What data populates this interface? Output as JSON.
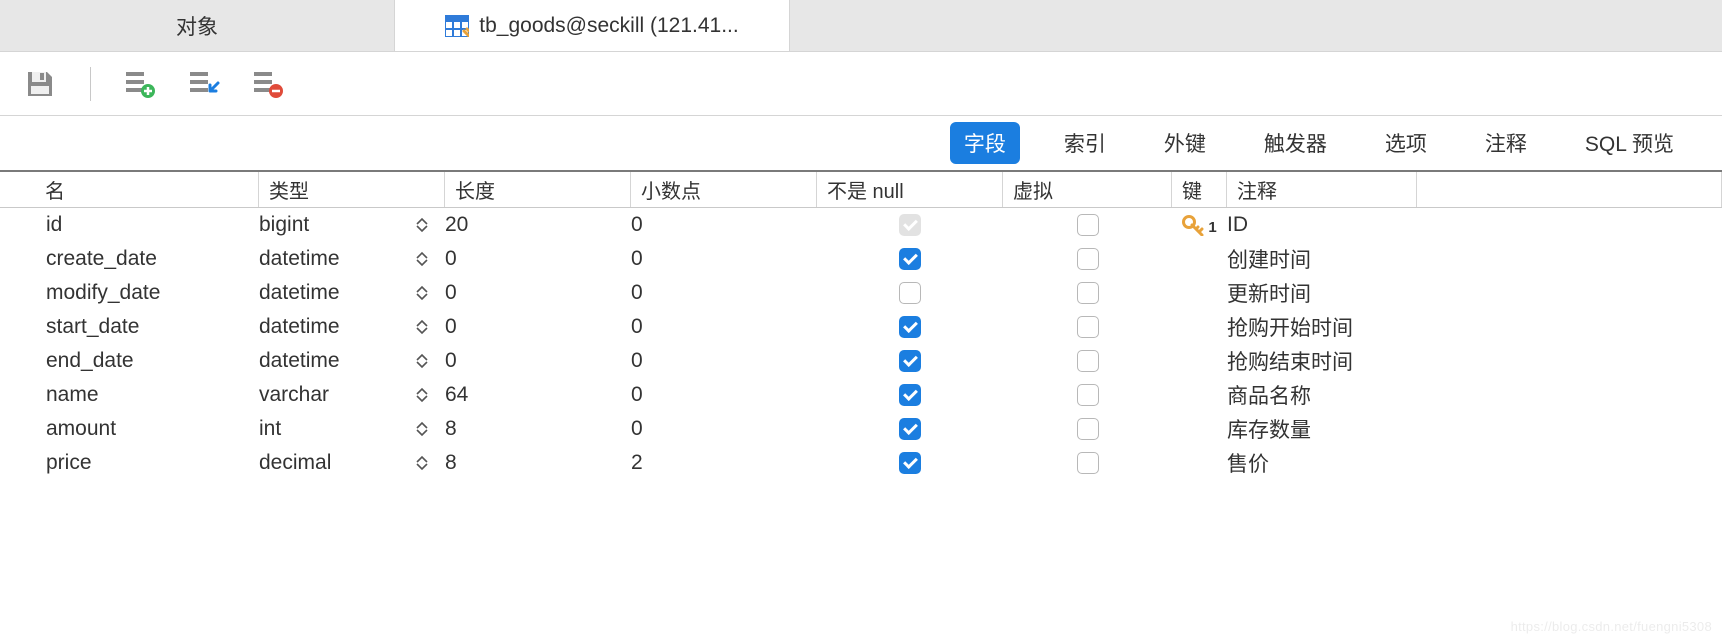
{
  "tabs": {
    "object_label": "对象",
    "table_label": "tb_goods@seckill (121.41..."
  },
  "subtabs": {
    "fields": "字段",
    "indexes": "索引",
    "fkeys": "外键",
    "triggers": "触发器",
    "options": "选项",
    "comment": "注释",
    "sqlpreview": "SQL 预览"
  },
  "headers": {
    "name": "名",
    "type": "类型",
    "length": "长度",
    "decimals": "小数点",
    "notnull": "不是 null",
    "virtual": "虚拟",
    "key": "键",
    "comment": "注释"
  },
  "rows": [
    {
      "name": "id",
      "type": "bigint",
      "length": "20",
      "decimals": "0",
      "notnull": true,
      "disabled": true,
      "virtual": false,
      "iskey": true,
      "keynum": "1",
      "comment": "ID"
    },
    {
      "name": "create_date",
      "type": "datetime",
      "length": "0",
      "decimals": "0",
      "notnull": true,
      "disabled": false,
      "virtual": false,
      "iskey": false,
      "keynum": "",
      "comment": "创建时间"
    },
    {
      "name": "modify_date",
      "type": "datetime",
      "length": "0",
      "decimals": "0",
      "notnull": false,
      "disabled": false,
      "virtual": false,
      "iskey": false,
      "keynum": "",
      "comment": "更新时间"
    },
    {
      "name": "start_date",
      "type": "datetime",
      "length": "0",
      "decimals": "0",
      "notnull": true,
      "disabled": false,
      "virtual": false,
      "iskey": false,
      "keynum": "",
      "comment": "抢购开始时间"
    },
    {
      "name": "end_date",
      "type": "datetime",
      "length": "0",
      "decimals": "0",
      "notnull": true,
      "disabled": false,
      "virtual": false,
      "iskey": false,
      "keynum": "",
      "comment": "抢购结束时间"
    },
    {
      "name": "name",
      "type": "varchar",
      "length": "64",
      "decimals": "0",
      "notnull": true,
      "disabled": false,
      "virtual": false,
      "iskey": false,
      "keynum": "",
      "comment": "商品名称"
    },
    {
      "name": "amount",
      "type": "int",
      "length": "8",
      "decimals": "0",
      "notnull": true,
      "disabled": false,
      "virtual": false,
      "iskey": false,
      "keynum": "",
      "comment": "库存数量"
    },
    {
      "name": "price",
      "type": "decimal",
      "length": "8",
      "decimals": "2",
      "notnull": true,
      "disabled": false,
      "virtual": false,
      "iskey": false,
      "keynum": "",
      "comment": "售价"
    }
  ],
  "watermark": "https://blog.csdn.net/fuengni5308"
}
